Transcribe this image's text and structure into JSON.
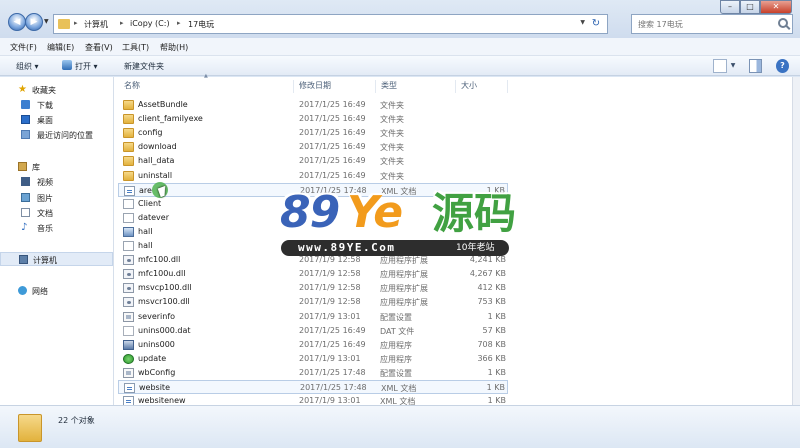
{
  "address": {
    "crumbs": [
      "计算机",
      "iCopy (C:)",
      "17电玩"
    ],
    "search_placeholder": "搜索 17电玩"
  },
  "menu": [
    "文件(F)",
    "编辑(E)",
    "查看(V)",
    "工具(T)",
    "帮助(H)"
  ],
  "toolbar": {
    "organize": "组织 ▾",
    "open": "打开 ▾",
    "new_folder": "新建文件夹"
  },
  "nav": {
    "favorites": "收藏夹",
    "downloads": "下载",
    "desktop": "桌面",
    "recent": "最近访问的位置",
    "libraries": "库",
    "videos": "视频",
    "pictures": "图片",
    "documents": "文档",
    "music": "音乐",
    "computer": "计算机",
    "network": "网络"
  },
  "columns": {
    "name": "名称",
    "date": "修改日期",
    "type": "类型",
    "size": "大小"
  },
  "files": [
    {
      "name": "AssetBundle",
      "date": "2017/1/25 16:49",
      "type": "文件夹",
      "size": "",
      "icon": "folder-icon"
    },
    {
      "name": "client_familyexe",
      "date": "2017/1/25 16:49",
      "type": "文件夹",
      "size": "",
      "icon": "folder-icon"
    },
    {
      "name": "config",
      "date": "2017/1/25 16:49",
      "type": "文件夹",
      "size": "",
      "icon": "folder-icon"
    },
    {
      "name": "download",
      "date": "2017/1/25 16:49",
      "type": "文件夹",
      "size": "",
      "icon": "folder-icon"
    },
    {
      "name": "hall_data",
      "date": "2017/1/25 16:49",
      "type": "文件夹",
      "size": "",
      "icon": "folder-icon"
    },
    {
      "name": "uninstall",
      "date": "2017/1/25 16:49",
      "type": "文件夹",
      "size": "",
      "icon": "folder-icon"
    },
    {
      "name": "are",
      "date": "2017/1/25 17:48",
      "type": "XML 文档",
      "size": "1 KB",
      "icon": "xml-file-icon"
    },
    {
      "name": "Client",
      "date": "",
      "type": "",
      "size": "",
      "icon": "file-icon"
    },
    {
      "name": "datever",
      "date": "",
      "type": "",
      "size": "",
      "icon": "file-icon"
    },
    {
      "name": "hall",
      "date": "",
      "type": "",
      "size": "",
      "icon": "app-icon"
    },
    {
      "name": "hall",
      "date": "",
      "type": "",
      "size": "",
      "icon": "file-icon"
    },
    {
      "name": "mfc100.dll",
      "date": "2017/1/9 12:58",
      "type": "应用程序扩展",
      "size": "4,241 KB",
      "icon": "dll-icon"
    },
    {
      "name": "mfc100u.dll",
      "date": "2017/1/9 12:58",
      "type": "应用程序扩展",
      "size": "4,267 KB",
      "icon": "dll-icon"
    },
    {
      "name": "msvcp100.dll",
      "date": "2017/1/9 12:58",
      "type": "应用程序扩展",
      "size": "412 KB",
      "icon": "dll-icon"
    },
    {
      "name": "msvcr100.dll",
      "date": "2017/1/9 12:58",
      "type": "应用程序扩展",
      "size": "753 KB",
      "icon": "dll-icon"
    },
    {
      "name": "severinfo",
      "date": "2017/1/9 13:01",
      "type": "配置设置",
      "size": "1 KB",
      "icon": "ini-icon"
    },
    {
      "name": "unins000.dat",
      "date": "2017/1/25 16:49",
      "type": "DAT 文件",
      "size": "57 KB",
      "icon": "dat-file-icon"
    },
    {
      "name": "unins000",
      "date": "2017/1/25 16:49",
      "type": "应用程序",
      "size": "708 KB",
      "icon": "installer-icon"
    },
    {
      "name": "update",
      "date": "2017/1/9 13:01",
      "type": "应用程序",
      "size": "366 KB",
      "icon": "update-app-icon"
    },
    {
      "name": "wbConfig",
      "date": "2017/1/25 17:48",
      "type": "配置设置",
      "size": "1 KB",
      "icon": "ini-icon"
    },
    {
      "name": "website",
      "date": "2017/1/25 17:48",
      "type": "XML 文档",
      "size": "1 KB",
      "icon": "xml-file-icon"
    },
    {
      "name": "websitenew",
      "date": "2017/1/9 13:01",
      "type": "XML 文档",
      "size": "1 KB",
      "icon": "xml-file-icon"
    }
  ],
  "status": {
    "count": "22 个对象"
  },
  "watermark": {
    "num": "89",
    "ye": "Ye",
    "cn": "源码",
    "url": "www.89YE.Com",
    "years": "10年老站"
  },
  "colors": {
    "accent": "#3a63b8",
    "watermark_orange": "#f29b1c",
    "watermark_green": "#41a142"
  }
}
